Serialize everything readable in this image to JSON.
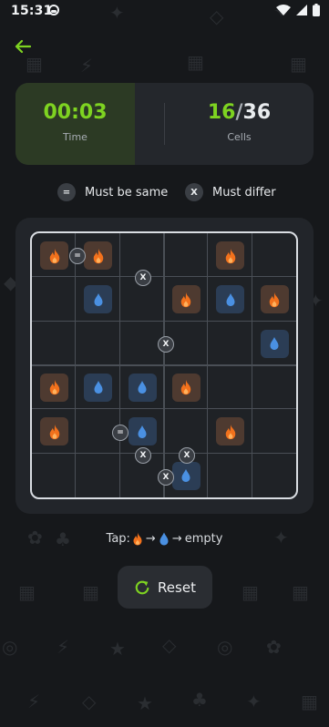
{
  "status": {
    "time": "15:31"
  },
  "stats": {
    "time_value": "00:03",
    "time_label": "Time",
    "cells_filled": "16",
    "cells_sep": "/",
    "cells_total": "36",
    "cells_label": "Cells"
  },
  "legend": {
    "same_symbol": "=",
    "same_label": "Must be same",
    "differ_symbol": "X",
    "differ_label": "Must differ"
  },
  "board": {
    "size": 6,
    "cells": [
      [
        "sun",
        "sun",
        "",
        "",
        "sun",
        ""
      ],
      [
        "",
        "moon",
        "",
        "sun",
        "moon",
        "sun"
      ],
      [
        "",
        "",
        "",
        "",
        "",
        "moon"
      ],
      [
        "sun",
        "moon",
        "moon",
        "sun",
        "",
        ""
      ],
      [
        "sun",
        "",
        "moon",
        "",
        "sun",
        ""
      ],
      [
        "",
        "",
        "",
        "moon",
        "",
        ""
      ]
    ],
    "constraints": [
      {
        "type": "=",
        "label": "="
      },
      {
        "type": "x",
        "label": "X"
      },
      {
        "type": "x",
        "label": "X"
      },
      {
        "type": "=",
        "label": "="
      },
      {
        "type": "x",
        "label": "X"
      },
      {
        "type": "x",
        "label": "X"
      },
      {
        "type": "x",
        "label": "X"
      }
    ]
  },
  "hint": {
    "prefix": "Tap:",
    "arrow": "→",
    "suffix": "empty"
  },
  "reset": {
    "label": "Reset"
  },
  "colors": {
    "accent": "#7ed321",
    "sun": "#f2711c",
    "moon": "#4a90e2"
  }
}
